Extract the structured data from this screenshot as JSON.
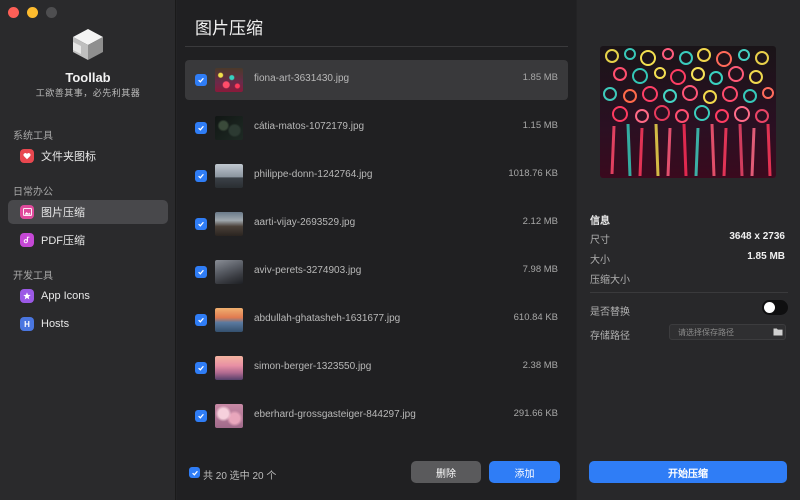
{
  "app": {
    "name": "Toollab",
    "slogan": "工欲善其事，必先利其器"
  },
  "sidebar": {
    "sections": [
      {
        "label": "系统工具",
        "items": [
          {
            "label": "文件夹图标",
            "icon": "folder-heart-icon",
            "color": "#e8474f"
          }
        ]
      },
      {
        "label": "日常办公",
        "items": [
          {
            "label": "图片压缩",
            "icon": "image-icon",
            "color": "#e04a9c",
            "active": true
          },
          {
            "label": "PDF压缩",
            "icon": "pdf-icon",
            "color": "#c548d6"
          }
        ]
      },
      {
        "label": "开发工具",
        "items": [
          {
            "label": "App Icons",
            "icon": "app-store-icon",
            "color": "#9b59e6"
          },
          {
            "label": "Hosts",
            "icon": "hosts-icon",
            "color": "#4a76e0",
            "glyph": "H"
          }
        ]
      }
    ]
  },
  "main": {
    "title": "图片压缩",
    "files": [
      {
        "name": "fiona-art-3631430.jpg",
        "size": "1.85 MB",
        "checked": true,
        "selected": true,
        "thumb": "psychedelic"
      },
      {
        "name": "cátia-matos-1072179.jpg",
        "size": "1.15 MB",
        "checked": true,
        "thumb": "dark-leaves"
      },
      {
        "name": "philippe-donn-1242764.jpg",
        "size": "1018.76 KB",
        "checked": true,
        "thumb": "palms"
      },
      {
        "name": "aarti-vijay-2693529.jpg",
        "size": "2.12 MB",
        "checked": true,
        "thumb": "hills"
      },
      {
        "name": "aviv-perets-3274903.jpg",
        "size": "7.98 MB",
        "checked": true,
        "thumb": "mountain"
      },
      {
        "name": "abdullah-ghatasheh-1631677.jpg",
        "size": "610.84 KB",
        "checked": true,
        "thumb": "sunset-sea"
      },
      {
        "name": "simon-berger-1323550.jpg",
        "size": "2.38 MB",
        "checked": true,
        "thumb": "pink-dusk"
      },
      {
        "name": "eberhard-grossgasteiger-844297.jpg",
        "size": "291.66 KB",
        "checked": true,
        "thumb": "pink-clouds"
      }
    ],
    "footer": {
      "summary": "共 20 选中 20 个",
      "delete_label": "删除",
      "add_label": "添加"
    }
  },
  "detail": {
    "info_title": "信息",
    "dimension_label": "尺寸",
    "dimension_value": "3648 x 2736",
    "size_label": "大小",
    "size_value": "1.85 MB",
    "compressed_label": "压缩大小",
    "compressed_value": "",
    "replace_label": "是否替换",
    "replace_on": false,
    "path_label": "存储路径",
    "path_placeholder": "请选择保存路径",
    "start_label": "开始压缩"
  },
  "colors": {
    "accent": "#2f7df6"
  }
}
